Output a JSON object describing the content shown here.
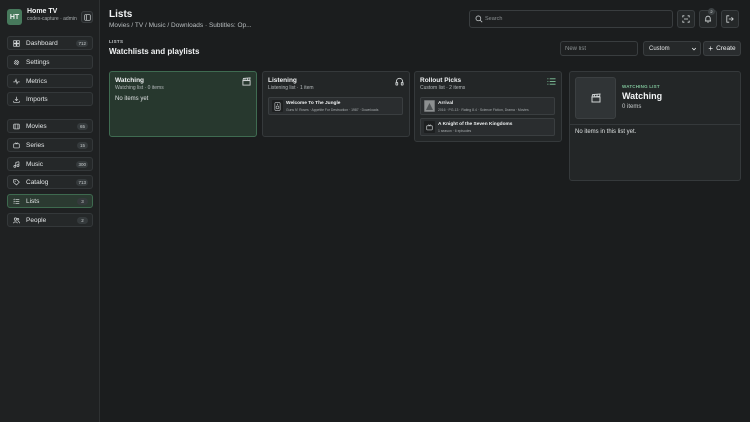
{
  "sidebar": {
    "avatar": "HT",
    "brand_name": "Home TV",
    "brand_sub": "codex-capture · admin",
    "groups": [
      [
        {
          "name": "dashboard",
          "label": "Dashboard",
          "count": "712",
          "icon": "dashboard-icon"
        },
        {
          "name": "settings",
          "label": "Settings",
          "count": "",
          "icon": "gear-icon"
        },
        {
          "name": "metrics",
          "label": "Metrics",
          "count": "",
          "icon": "pulse-icon"
        },
        {
          "name": "imports",
          "label": "Imports",
          "count": "",
          "icon": "download-icon"
        }
      ],
      [
        {
          "name": "movies",
          "label": "Movies",
          "count": "65",
          "icon": "film-icon"
        },
        {
          "name": "series",
          "label": "Series",
          "count": "15",
          "icon": "tv-icon"
        },
        {
          "name": "music",
          "label": "Music",
          "count": "300",
          "icon": "music-icon"
        },
        {
          "name": "catalog",
          "label": "Catalog",
          "count": "713",
          "icon": "tag-icon"
        },
        {
          "name": "lists",
          "label": "Lists",
          "count": "3",
          "icon": "list-icon",
          "active": true
        },
        {
          "name": "people",
          "label": "People",
          "count": "2",
          "icon": "people-icon"
        }
      ]
    ]
  },
  "header": {
    "title": "Lists",
    "breadcrumb": "Movies / TV / Music / Downloads · Subtitles: Op...",
    "search_placeholder": "Search",
    "notification_count": "2"
  },
  "section": {
    "label": "LISTS",
    "title": "Watchlists and playlists",
    "new_list_placeholder": "New list",
    "type_select": "Custom",
    "create_label": "Create"
  },
  "cards": [
    {
      "title": "Watching",
      "meta": "Watching list · 0 items",
      "empty": "No items yet",
      "icon": "clapperboard-icon",
      "items": []
    },
    {
      "title": "Listening",
      "meta": "Listening list · 1 item",
      "icon": "headphones-icon",
      "items": [
        {
          "title": "Welcome To The Jungle",
          "sub": "Guns N' Roses · Appetite For Destruction · 1987 · Downloads",
          "thumb": "speaker-icon"
        }
      ]
    },
    {
      "title": "Rollout Picks",
      "meta": "Custom list · 2 items",
      "icon": "list-icon",
      "items": [
        {
          "title": "Arrival",
          "sub": "2016 · PG-13 · Rating 8.4 · Science Fiction, Drama · Movies",
          "thumb": "poster-icon"
        },
        {
          "title": "A Knight of the Seven Kingdoms",
          "sub": "1 season · 6 episodes",
          "thumb": "tv-icon"
        }
      ]
    }
  ],
  "detail": {
    "kicker": "WATCHING LIST",
    "title": "Watching",
    "count": "0 items",
    "empty": "No items in this list yet."
  },
  "colors": {
    "accent": "#47795c",
    "accent_text": "#7fc39a",
    "background": "#1b1d1e"
  }
}
